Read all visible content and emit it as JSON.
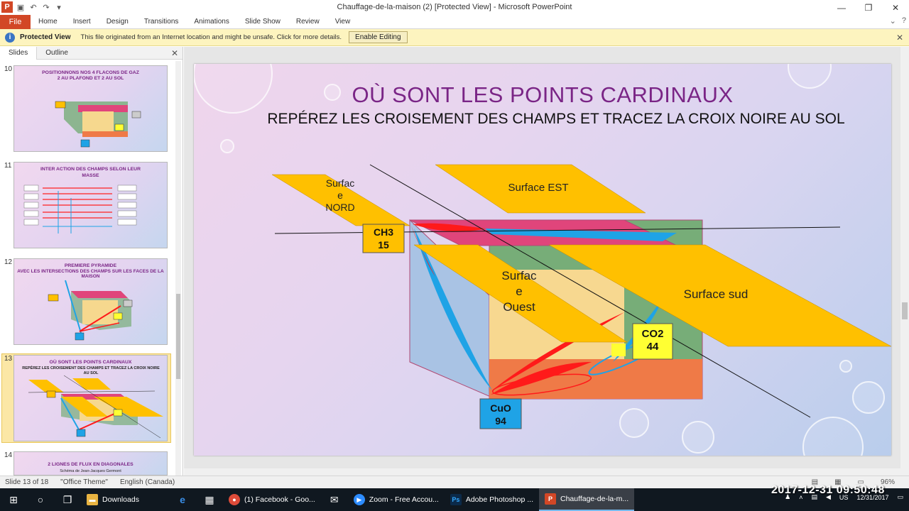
{
  "window": {
    "title": "Chauffage-de-la-maison (2) [Protected View] - Microsoft PowerPoint",
    "app_letter": "P",
    "minimize_glyph": "—",
    "maximize_glyph": "❐",
    "close_glyph": "✕"
  },
  "ribbon": {
    "file_tab": "File",
    "tabs": [
      "Home",
      "Insert",
      "Design",
      "Transitions",
      "Animations",
      "Slide Show",
      "Review",
      "View"
    ]
  },
  "protected_view": {
    "title": "Protected View",
    "message": "This file originated from an Internet location and might be unsafe. Click for more details.",
    "button": "Enable Editing"
  },
  "left_pane": {
    "tabs": [
      "Slides",
      "Outline"
    ],
    "thumbnails": [
      {
        "number": "10",
        "title": "POSITIONNONS NOS 4 FLACONS DE GAZ",
        "subtitle": "2 AU PLAFOND ET 2 AU SOL"
      },
      {
        "number": "11",
        "title": "INTER ACTION DES CHAMPS SELON LEUR",
        "subtitle": "MASSE"
      },
      {
        "number": "12",
        "title": "PREMIERE PYRAMIDE",
        "subtitle": "AVEC LES INTERSECTIONS DES CHAMPS SUR LES FACES DE LA MAISON"
      },
      {
        "number": "13",
        "title": "OÙ SONT LES POINTS CARDINAUX",
        "subtitle": "REPÉREZ LES CROISEMENT DES CHAMPS ET TRACEZ LA CROIX NOIRE AU SOL"
      },
      {
        "number": "14",
        "title": "2 LIGNES DE FLUX EN DIAGONALES",
        "subtitle": "Schéma de Jean-Jacques Germont"
      }
    ]
  },
  "slide": {
    "title": "OÙ SONT LES POINTS CARDINAUX",
    "subtitle": "REPÉREZ LES CROISEMENT DES CHAMPS ET TRACEZ LA CROIX NOIRE AU SOL",
    "surface_nord_lines": [
      "Surfac",
      "e",
      "NORD"
    ],
    "surface_est": "Surface EST",
    "surface_ouest_lines": [
      "Surfac",
      "e",
      "Ouest"
    ],
    "surface_sud": "Surface sud",
    "ch3": {
      "name": "CH3",
      "value": "15"
    },
    "co2": {
      "name": "CO2",
      "value": "44"
    },
    "cuo": {
      "name": "CuO",
      "value": "94"
    },
    "colors": {
      "title": "#7a2586",
      "plane": "#ffc000",
      "red_field": "#ff1a1a",
      "blue_field": "#1fa3e6",
      "roof": "#e0457b",
      "wall_green": "#77ad78",
      "floor": "#ef7a47"
    }
  },
  "status_bar": {
    "slide_info": "Slide 13 of 18",
    "theme": "\"Office Theme\"",
    "language": "English (Canada)",
    "zoom": "96%"
  },
  "taskbar": {
    "apps": [
      {
        "label": "Downloads",
        "icon": "folder-icon"
      },
      {
        "label": "(1) Facebook - Goo...",
        "icon": "chrome-icon"
      },
      {
        "label": "Zoom - Free Accou...",
        "icon": "zoom-icon"
      },
      {
        "label": "Adobe Photoshop ...",
        "icon": "photoshop-icon"
      },
      {
        "label": "Chauffage-de-la-m...",
        "icon": "powerpoint-icon"
      }
    ],
    "clock_overlay": "2017-12-31 09:50:48",
    "tray_lang": "US",
    "tray_date": "12/31/2017"
  }
}
